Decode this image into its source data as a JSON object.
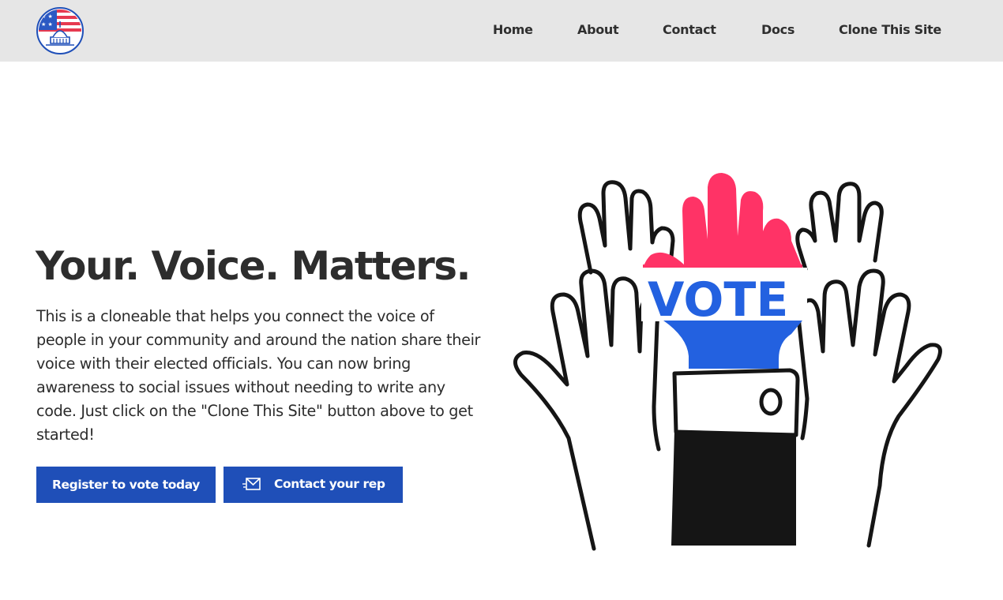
{
  "nav": {
    "logo": "capitol-flag-logo",
    "links": [
      "Home",
      "About",
      "Contact",
      "Docs",
      "Clone This Site"
    ]
  },
  "hero": {
    "title": "Your. Voice. Matters.",
    "text": "This is a cloneable that helps you connect the voice of people in your community and around the nation share their voice with their elected officials. You can now bring awareness to social issues without needing to write any code. Just click on the \"Clone This Site\" button above to get started!",
    "buttons": {
      "register": "Register to vote today",
      "contact": "Contact your rep",
      "contact_icon": "mail-icon"
    }
  },
  "illustration": {
    "sign_text": "VOTE",
    "icon": "raised-hands-vote-illustration"
  },
  "colors": {
    "nav_bg": "#e6e6e6",
    "button_bg": "#1f4fb8",
    "vote_red": "#ff3366",
    "vote_blue": "#2361e0",
    "text": "#2d2d2d"
  }
}
